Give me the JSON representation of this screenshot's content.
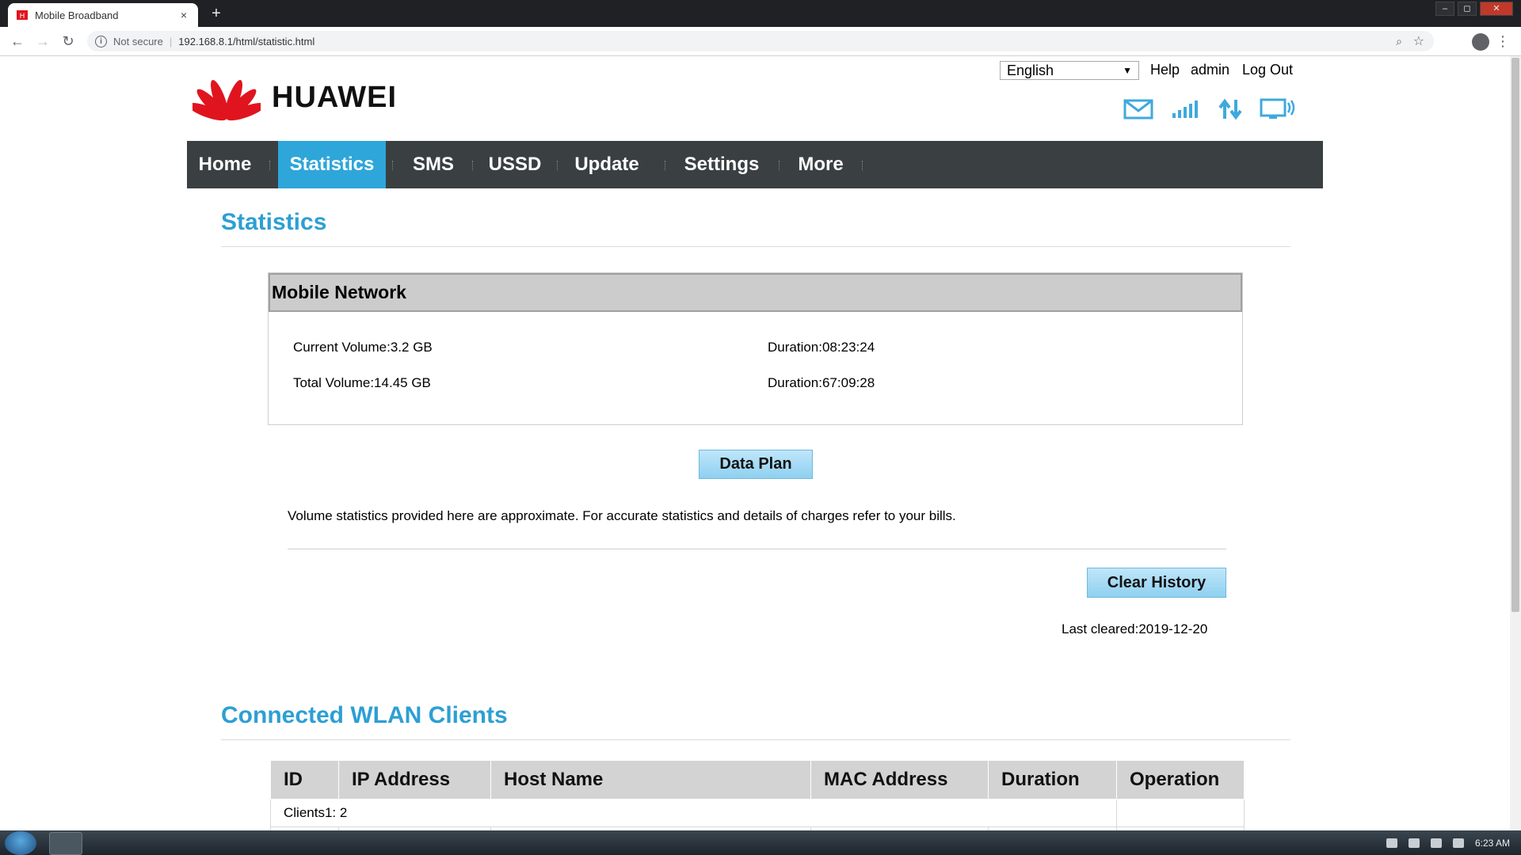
{
  "browser": {
    "tab_title": "Mobile Broadband",
    "tab_close": "×",
    "new_tab": "+",
    "security_label": "Not secure",
    "url": "192.168.8.1/html/statistic.html",
    "window_controls": [
      "–",
      "◻",
      "✕"
    ]
  },
  "header": {
    "language": "English",
    "links": [
      "Help",
      "admin",
      "Log Out"
    ],
    "logo_text": "HUAWEI",
    "status_icons": [
      "mail-icon",
      "signal-icon",
      "data-transfer-icon",
      "pc-connect-icon"
    ]
  },
  "nav": {
    "items": [
      "Home",
      "Statistics",
      "SMS",
      "USSD",
      "Update",
      "Settings",
      "More"
    ],
    "active": "Statistics"
  },
  "statistics": {
    "title": "Statistics",
    "panel_title": "Mobile Network",
    "current_volume": "Current Volume:3.2 GB",
    "current_duration": "Duration:08:23:24",
    "total_volume": "Total Volume:14.45 GB",
    "total_duration": "Duration:67:09:28",
    "data_plan_button": "Data Plan",
    "notice": "Volume statistics provided here are approximate. For accurate statistics and details of charges refer to your bills.",
    "clear_history_button": "Clear History",
    "last_cleared": "Last cleared:2019-12-20"
  },
  "clients": {
    "title": "Connected WLAN Clients",
    "columns": [
      "ID",
      "IP Address",
      "Host Name",
      "MAC Address",
      "Duration",
      "Operation"
    ],
    "summary": "Clients1: 2"
  },
  "taskbar": {
    "clock": "6:23 AM"
  },
  "colors": {
    "accent": "#2ea6d9",
    "nav_bg": "#3a3f42",
    "title_blue": "#2d9fd3",
    "logo_red": "#e0141e"
  }
}
